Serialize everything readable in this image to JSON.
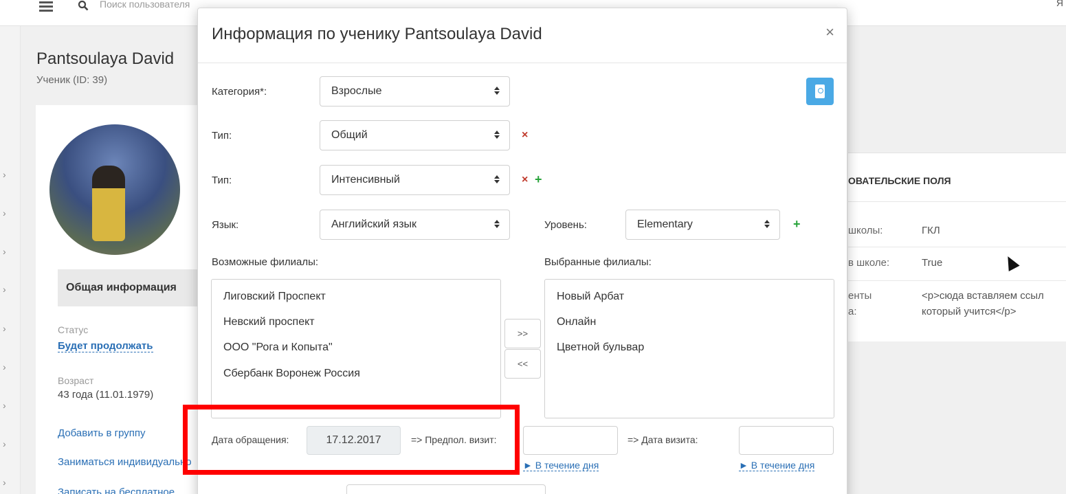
{
  "topbar": {
    "search_placeholder": "Поиск пользователя",
    "right_icon": "Я"
  },
  "rail": {
    "arrow": "›"
  },
  "profile": {
    "name": "Pantsoulaya David",
    "subtitle": "Ученик (ID: 39)",
    "general_info": "Общая информация",
    "status_label": "Статус",
    "status_value": "Будет продолжать",
    "age_label": "Возраст",
    "age_value": "43 года (11.01.1979)",
    "links": [
      "Добавить в группу",
      "Заниматься индивидуально",
      "Записать на бесплатное"
    ]
  },
  "custom_fields": {
    "heading": "ОВАТЕЛЬСКИЕ ПОЛЯ",
    "rows": [
      {
        "label": "школы:",
        "value": "ГКЛ"
      },
      {
        "label": "в школе:",
        "value": "True"
      },
      {
        "label": "енты",
        "label2": "а:",
        "value": "<p>сюда вставляем ссыл",
        "value2": "который учится</p>"
      }
    ]
  },
  "modal": {
    "title": "Информация по ученику Pantsoulaya David",
    "close_label": "×",
    "category": {
      "label": "Категория*:",
      "value": "Взрослые"
    },
    "type1": {
      "label": "Тип:",
      "value": "Общий"
    },
    "type2": {
      "label": "Тип:",
      "value": "Интенсивный"
    },
    "language": {
      "label": "Язык:",
      "value": "Английский язык"
    },
    "level": {
      "label": "Уровень:",
      "value": "Elementary"
    },
    "remove_symbol": "×",
    "add_symbol": "+",
    "available_branches": {
      "label": "Возможные филиалы:",
      "items": [
        "Лиговский Проспект",
        "Невский проспект",
        "ООО \"Рога и Копыта\"",
        "Сбербанк Воронеж Россия"
      ]
    },
    "selected_branches": {
      "label": "Выбранные филиалы:",
      "items": [
        "Новый Арбат",
        "Онлайн",
        "Цветной бульвар"
      ]
    },
    "move_right": ">>",
    "move_left": "<<",
    "request_date": {
      "label": "Дата обращения:",
      "value": "17.12.2017"
    },
    "planned_visit": {
      "label": "=> Предпол. визит:",
      "value": ""
    },
    "visit_date": {
      "label": "=> Дата визита:",
      "value": ""
    },
    "within_day": "► В течение дня"
  },
  "colors": {
    "highlight": "#ff0000",
    "link": "#2a6fb5",
    "remove": "#c0392b",
    "add": "#27a33a",
    "passport_button": "#4aa9e5"
  }
}
